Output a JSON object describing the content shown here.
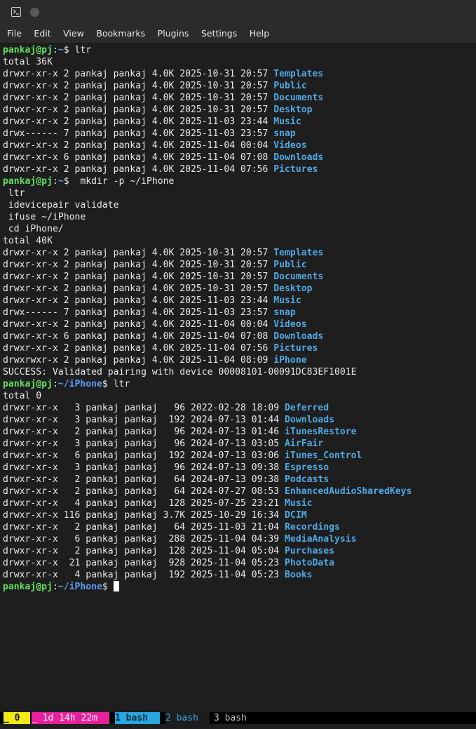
{
  "window": {
    "menu": [
      "File",
      "Edit",
      "View",
      "Bookmarks",
      "Plugins",
      "Settings",
      "Help"
    ]
  },
  "terminal": {
    "lines": [
      {
        "type": "prompt",
        "user": "pankaj@pj",
        "path": "~",
        "cmd": " ltr"
      },
      {
        "type": "text",
        "text": "total 36K"
      },
      {
        "type": "ls",
        "meta": "drwxr-xr-x 2 pankaj pankaj 4.0K 2025-10-31 20:57 ",
        "name": "Templates"
      },
      {
        "type": "ls",
        "meta": "drwxr-xr-x 2 pankaj pankaj 4.0K 2025-10-31 20:57 ",
        "name": "Public"
      },
      {
        "type": "ls",
        "meta": "drwxr-xr-x 2 pankaj pankaj 4.0K 2025-10-31 20:57 ",
        "name": "Documents"
      },
      {
        "type": "ls",
        "meta": "drwxr-xr-x 2 pankaj pankaj 4.0K 2025-10-31 20:57 ",
        "name": "Desktop"
      },
      {
        "type": "ls",
        "meta": "drwxr-xr-x 2 pankaj pankaj 4.0K 2025-11-03 23:44 ",
        "name": "Music"
      },
      {
        "type": "ls",
        "meta": "drwx------ 7 pankaj pankaj 4.0K 2025-11-03 23:57 ",
        "name": "snap"
      },
      {
        "type": "ls",
        "meta": "drwxr-xr-x 2 pankaj pankaj 4.0K 2025-11-04 00:04 ",
        "name": "Videos"
      },
      {
        "type": "ls",
        "meta": "drwxr-xr-x 6 pankaj pankaj 4.0K 2025-11-04 07:08 ",
        "name": "Downloads"
      },
      {
        "type": "ls",
        "meta": "drwxr-xr-x 2 pankaj pankaj 4.0K 2025-11-04 07:56 ",
        "name": "Pictures"
      },
      {
        "type": "prompt",
        "user": "pankaj@pj",
        "path": "~",
        "cmd": "  mkdir -p ~/iPhone"
      },
      {
        "type": "text",
        "text": " ltr"
      },
      {
        "type": "text",
        "text": " idevicepair validate"
      },
      {
        "type": "text",
        "text": " ifuse ~/iPhone"
      },
      {
        "type": "text",
        "text": " cd iPhone/"
      },
      {
        "type": "text",
        "text": "total 40K"
      },
      {
        "type": "ls",
        "meta": "drwxr-xr-x 2 pankaj pankaj 4.0K 2025-10-31 20:57 ",
        "name": "Templates"
      },
      {
        "type": "ls",
        "meta": "drwxr-xr-x 2 pankaj pankaj 4.0K 2025-10-31 20:57 ",
        "name": "Public"
      },
      {
        "type": "ls",
        "meta": "drwxr-xr-x 2 pankaj pankaj 4.0K 2025-10-31 20:57 ",
        "name": "Documents"
      },
      {
        "type": "ls",
        "meta": "drwxr-xr-x 2 pankaj pankaj 4.0K 2025-10-31 20:57 ",
        "name": "Desktop"
      },
      {
        "type": "ls",
        "meta": "drwxr-xr-x 2 pankaj pankaj 4.0K 2025-11-03 23:44 ",
        "name": "Music"
      },
      {
        "type": "ls",
        "meta": "drwx------ 7 pankaj pankaj 4.0K 2025-11-03 23:57 ",
        "name": "snap"
      },
      {
        "type": "ls",
        "meta": "drwxr-xr-x 2 pankaj pankaj 4.0K 2025-11-04 00:04 ",
        "name": "Videos"
      },
      {
        "type": "ls",
        "meta": "drwxr-xr-x 6 pankaj pankaj 4.0K 2025-11-04 07:08 ",
        "name": "Downloads"
      },
      {
        "type": "ls",
        "meta": "drwxr-xr-x 2 pankaj pankaj 4.0K 2025-11-04 07:56 ",
        "name": "Pictures"
      },
      {
        "type": "ls",
        "meta": "drwxrwxr-x 2 pankaj pankaj 4.0K 2025-11-04 08:09 ",
        "name": "iPhone"
      },
      {
        "type": "text",
        "text": "SUCCESS: Validated pairing with device 00008101-00091DC83EF1001E"
      },
      {
        "type": "prompt",
        "user": "pankaj@pj",
        "path": "~/iPhone",
        "cmd": " ltr"
      },
      {
        "type": "text",
        "text": "total 0"
      },
      {
        "type": "ls",
        "meta": "drwxr-xr-x   3 pankaj pankaj   96 2022-02-28 18:09 ",
        "name": "Deferred"
      },
      {
        "type": "ls",
        "meta": "drwxr-xr-x   3 pankaj pankaj  192 2024-07-13 01:44 ",
        "name": "Downloads"
      },
      {
        "type": "ls",
        "meta": "drwxr-xr-x   2 pankaj pankaj   96 2024-07-13 01:46 ",
        "name": "iTunesRestore"
      },
      {
        "type": "ls",
        "meta": "drwxr-xr-x   3 pankaj pankaj   96 2024-07-13 03:05 ",
        "name": "AirFair"
      },
      {
        "type": "ls",
        "meta": "drwxr-xr-x   6 pankaj pankaj  192 2024-07-13 03:06 ",
        "name": "iTunes_Control"
      },
      {
        "type": "ls",
        "meta": "drwxr-xr-x   3 pankaj pankaj   96 2024-07-13 09:38 ",
        "name": "Espresso"
      },
      {
        "type": "ls",
        "meta": "drwxr-xr-x   2 pankaj pankaj   64 2024-07-13 09:38 ",
        "name": "Podcasts"
      },
      {
        "type": "ls",
        "meta": "drwxr-xr-x   2 pankaj pankaj   64 2024-07-27 08:53 ",
        "name": "EnhancedAudioSharedKeys"
      },
      {
        "type": "ls",
        "meta": "drwxr-xr-x   4 pankaj pankaj  128 2025-07-25 23:21 ",
        "name": "Music"
      },
      {
        "type": "ls",
        "meta": "drwxr-xr-x 116 pankaj pankaj 3.7K 2025-10-29 16:34 ",
        "name": "DCIM"
      },
      {
        "type": "ls",
        "meta": "drwxr-xr-x   2 pankaj pankaj   64 2025-11-03 21:04 ",
        "name": "Recordings"
      },
      {
        "type": "ls",
        "meta": "drwxr-xr-x   6 pankaj pankaj  288 2025-11-04 04:39 ",
        "name": "MediaAnalysis"
      },
      {
        "type": "ls",
        "meta": "drwxr-xr-x   2 pankaj pankaj  128 2025-11-04 05:04 ",
        "name": "Purchases"
      },
      {
        "type": "ls",
        "meta": "drwxr-xr-x  21 pankaj pankaj  928 2025-11-04 05:23 ",
        "name": "PhotoData"
      },
      {
        "type": "ls",
        "meta": "drwxr-xr-x   4 pankaj pankaj  192 2025-11-04 05:23 ",
        "name": "Books"
      },
      {
        "type": "prompt",
        "user": "pankaj@pj",
        "path": "~/iPhone",
        "cmd": " ",
        "cursor": true
      }
    ]
  },
  "statusbar": {
    "session": "_ 0",
    "uptime": "_ 1d 14h 22m",
    "tabs": [
      "1 bash",
      "2 bash",
      "3 bash"
    ]
  },
  "colors": {
    "background": "#1e1e1e",
    "prompt_user": "#5fe05f",
    "prompt_path": "#5b9cf5",
    "directory": "#4fa8e3"
  }
}
